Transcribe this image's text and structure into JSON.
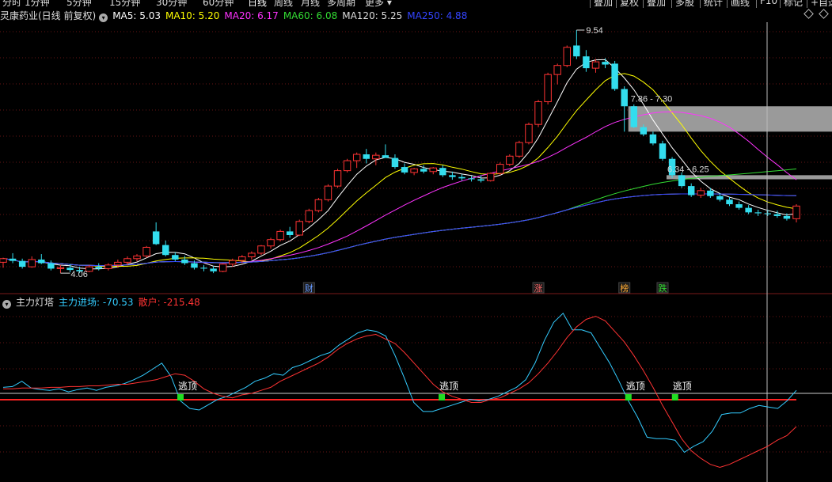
{
  "toolbar": {
    "periods": [
      "分时",
      "1分钟",
      "5分钟",
      "15分钟",
      "30分钟",
      "60分钟",
      "日线",
      "周线",
      "月线",
      "多周期",
      "更多 ▾"
    ],
    "active_period": "日线",
    "right_tabs": [
      "叠加",
      "复权",
      "叠加",
      "多股",
      "统计",
      "画线",
      "F10",
      "标记",
      "+自选"
    ]
  },
  "main_legend": {
    "title": "灵康药业(日线 前复权)",
    "ma5": "MA5: 5.03",
    "ma10": "MA10: 5.20",
    "ma20": "MA20: 6.17",
    "ma60": "MA60: 6.08",
    "ma120": "MA120: 5.25",
    "ma250": "MA250: 4.88",
    "colors": {
      "ma5": "#ffffff",
      "ma10": "#ffff00",
      "ma20": "#ff33ff",
      "ma60": "#33dd33",
      "ma120": "#dddddd",
      "ma250": "#3344ff"
    }
  },
  "annotations": {
    "high": "9.54",
    "low": "4.06",
    "gap1": "7.86 - 7.30",
    "gap2": "6.34 - 6.25"
  },
  "events": [
    {
      "label": "财",
      "color": "#6699ff"
    },
    {
      "label": "涨",
      "color": "#ff6666"
    },
    {
      "label": "榜",
      "color": "#ffaa33"
    },
    {
      "label": "跌",
      "color": "#33dd33"
    }
  ],
  "sub_legend": {
    "name": "主力灯塔",
    "line1": "主力进场: -70.53",
    "line2": "散户: -215.48",
    "colors": {
      "line1": "#33ccff",
      "line2": "#ff3333"
    }
  },
  "signal_label": "逃顶",
  "signals": [
    "逃顶",
    "逃顶",
    "逃顶",
    "逃顶"
  ],
  "chart_data": {
    "type": "candlestick",
    "title": "灵康药业(日线 前复权)",
    "ylim": [
      4.06,
      9.54
    ],
    "candles": [
      [
        4.42,
        4.52,
        4.3,
        4.5
      ],
      [
        4.5,
        4.62,
        4.4,
        4.45
      ],
      [
        4.45,
        4.5,
        4.28,
        4.32
      ],
      [
        4.32,
        4.55,
        4.3,
        4.48
      ],
      [
        4.48,
        4.6,
        4.38,
        4.4
      ],
      [
        4.4,
        4.46,
        4.24,
        4.28
      ],
      [
        4.28,
        4.36,
        4.18,
        4.3
      ],
      [
        4.3,
        4.38,
        4.2,
        4.25
      ],
      [
        4.25,
        4.32,
        4.18,
        4.22
      ],
      [
        4.22,
        4.36,
        4.2,
        4.32
      ],
      [
        4.32,
        4.4,
        4.24,
        4.28
      ],
      [
        4.28,
        4.4,
        4.24,
        4.36
      ],
      [
        4.36,
        4.48,
        4.3,
        4.42
      ],
      [
        4.42,
        4.55,
        4.36,
        4.5
      ],
      [
        4.5,
        4.6,
        4.44,
        4.56
      ],
      [
        4.56,
        4.78,
        4.52,
        4.75
      ],
      [
        5.1,
        5.3,
        4.8,
        4.82
      ],
      [
        4.8,
        4.9,
        4.55,
        4.58
      ],
      [
        4.58,
        4.64,
        4.44,
        4.48
      ],
      [
        4.48,
        4.56,
        4.36,
        4.4
      ],
      [
        4.4,
        4.46,
        4.26,
        4.3
      ],
      [
        4.3,
        4.36,
        4.22,
        4.28
      ],
      [
        4.28,
        4.34,
        4.18,
        4.22
      ],
      [
        4.22,
        4.4,
        4.2,
        4.38
      ],
      [
        4.38,
        4.5,
        4.32,
        4.46
      ],
      [
        4.46,
        4.58,
        4.4,
        4.54
      ],
      [
        4.54,
        4.66,
        4.48,
        4.62
      ],
      [
        4.62,
        4.8,
        4.58,
        4.78
      ],
      [
        4.78,
        4.96,
        4.72,
        4.92
      ],
      [
        4.92,
        5.14,
        4.88,
        5.1
      ],
      [
        5.1,
        5.2,
        4.96,
        5.02
      ],
      [
        5.02,
        5.36,
        5.0,
        5.32
      ],
      [
        5.32,
        5.6,
        5.28,
        5.56
      ],
      [
        5.56,
        5.84,
        5.52,
        5.8
      ],
      [
        5.8,
        6.14,
        5.76,
        6.1
      ],
      [
        6.1,
        6.48,
        6.06,
        6.44
      ],
      [
        6.44,
        6.7,
        6.4,
        6.66
      ],
      [
        6.66,
        6.84,
        6.5,
        6.8
      ],
      [
        6.8,
        6.92,
        6.6,
        6.7
      ],
      [
        6.7,
        6.84,
        6.56,
        6.78
      ],
      [
        6.78,
        7.02,
        6.74,
        6.72
      ],
      [
        6.72,
        6.8,
        6.48,
        6.52
      ],
      [
        6.52,
        6.6,
        6.36,
        6.4
      ],
      [
        6.4,
        6.5,
        6.34,
        6.48
      ],
      [
        6.48,
        6.56,
        6.38,
        6.42
      ],
      [
        6.42,
        6.52,
        6.36,
        6.5
      ],
      [
        6.5,
        6.56,
        6.3,
        6.34
      ],
      [
        6.34,
        6.42,
        6.24,
        6.3
      ],
      [
        6.3,
        6.36,
        6.22,
        6.27
      ],
      [
        6.27,
        6.32,
        6.2,
        6.25
      ],
      [
        6.25,
        6.34,
        6.18,
        6.22
      ],
      [
        6.22,
        6.4,
        6.2,
        6.38
      ],
      [
        6.38,
        6.62,
        6.34,
        6.58
      ],
      [
        6.58,
        6.8,
        6.54,
        6.76
      ],
      [
        6.76,
        7.1,
        6.72,
        7.06
      ],
      [
        7.06,
        7.5,
        7.02,
        7.46
      ],
      [
        7.46,
        8.0,
        7.4,
        7.96
      ],
      [
        7.96,
        8.6,
        7.9,
        8.56
      ],
      [
        8.56,
        8.8,
        8.34,
        8.76
      ],
      [
        8.76,
        9.2,
        8.72,
        9.16
      ],
      [
        9.2,
        9.54,
        8.9,
        8.96
      ],
      [
        8.96,
        9.1,
        8.62,
        8.7
      ],
      [
        8.7,
        8.9,
        8.6,
        8.84
      ],
      [
        8.84,
        8.92,
        8.7,
        8.78
      ],
      [
        8.8,
        8.86,
        8.2,
        8.24
      ],
      [
        8.24,
        8.3,
        7.3,
        7.86
      ],
      [
        7.86,
        7.9,
        7.38,
        7.4
      ],
      [
        7.4,
        7.46,
        7.2,
        7.24
      ],
      [
        7.24,
        7.3,
        7.0,
        7.04
      ],
      [
        7.04,
        7.1,
        6.66,
        6.7
      ],
      [
        6.7,
        6.74,
        6.28,
        6.34
      ],
      [
        6.34,
        6.4,
        6.06,
        6.1
      ],
      [
        6.1,
        6.16,
        5.86,
        5.9
      ],
      [
        5.9,
        6.06,
        5.84,
        6.0
      ],
      [
        6.0,
        6.06,
        5.84,
        5.88
      ],
      [
        5.88,
        5.94,
        5.76,
        5.8
      ],
      [
        5.8,
        5.86,
        5.66,
        5.7
      ],
      [
        5.7,
        5.76,
        5.58,
        5.62
      ],
      [
        5.62,
        5.68,
        5.48,
        5.52
      ],
      [
        5.52,
        5.58,
        5.44,
        5.5
      ],
      [
        5.5,
        5.58,
        5.44,
        5.48
      ],
      [
        5.48,
        5.56,
        5.4,
        5.44
      ],
      [
        5.44,
        5.5,
        5.34,
        5.38
      ],
      [
        5.38,
        5.7,
        5.3,
        5.66
      ]
    ],
    "indicator": {
      "name": "主力灯塔",
      "series": [
        {
          "name": "主力进场",
          "color": "#33ccff",
          "values": [
            -2,
            -1,
            6,
            -3,
            -5,
            -6,
            -4,
            -8,
            -5,
            -3,
            -6,
            -2,
            0,
            3,
            8,
            14,
            22,
            30,
            12,
            -20,
            -30,
            -32,
            -25,
            -18,
            -14,
            -8,
            -2,
            6,
            10,
            16,
            14,
            24,
            28,
            34,
            40,
            44,
            54,
            62,
            70,
            74,
            72,
            66,
            40,
            10,
            -22,
            -34,
            -34,
            -30,
            -26,
            -22,
            -18,
            -20,
            -18,
            -14,
            -8,
            -2,
            8,
            30,
            60,
            84,
            96,
            74,
            74,
            70,
            50,
            30,
            6,
            -20,
            -42,
            -68,
            -70,
            -70,
            -72,
            -88,
            -80,
            -74,
            -60,
            -38,
            -36,
            -36,
            -30,
            -26,
            -28,
            -30,
            -20,
            -6
          ]
        },
        {
          "name": "散户",
          "color": "#ff3333",
          "values": [
            -4,
            -4,
            -3,
            -3,
            -3,
            -2,
            -2,
            -1,
            -1,
            0,
            0,
            1,
            2,
            2,
            4,
            6,
            8,
            12,
            16,
            14,
            6,
            -4,
            -10,
            -14,
            -16,
            -12,
            -10,
            -6,
            -2,
            6,
            12,
            18,
            24,
            30,
            38,
            48,
            56,
            62,
            66,
            68,
            62,
            56,
            44,
            30,
            16,
            2,
            -8,
            -14,
            -18,
            -22,
            -22,
            -18,
            -16,
            -10,
            -4,
            4,
            16,
            30,
            46,
            64,
            78,
            88,
            92,
            86,
            72,
            58,
            40,
            20,
            -2,
            -26,
            -48,
            -70,
            -86,
            -96,
            -104,
            -108,
            -104,
            -98,
            -92,
            -86,
            -80,
            -72,
            -66,
            -54
          ]
        }
      ]
    }
  }
}
